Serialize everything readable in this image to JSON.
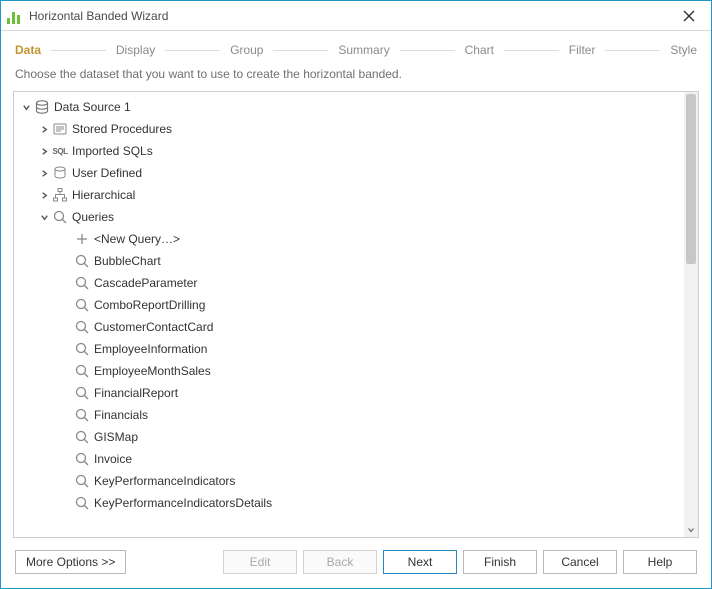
{
  "window": {
    "title": "Horizontal Banded Wizard"
  },
  "steps": [
    {
      "label": "Data",
      "active": true
    },
    {
      "label": "Display",
      "active": false
    },
    {
      "label": "Group",
      "active": false
    },
    {
      "label": "Summary",
      "active": false
    },
    {
      "label": "Chart",
      "active": false
    },
    {
      "label": "Filter",
      "active": false
    },
    {
      "label": "Style",
      "active": false
    }
  ],
  "description": "Choose the dataset that you want to use to create the horizontal banded.",
  "tree": {
    "root": {
      "label": "Data Source 1",
      "icon": "database-icon",
      "expanded": true
    },
    "folders": [
      {
        "label": "Stored Procedures",
        "icon": "stored-proc-icon",
        "expanded": false
      },
      {
        "label": "Imported SQLs",
        "icon": "sql-icon",
        "expanded": false
      },
      {
        "label": "User Defined",
        "icon": "user-def-icon",
        "expanded": false
      },
      {
        "label": "Hierarchical",
        "icon": "hierarchy-icon",
        "expanded": false
      }
    ],
    "queriesFolder": {
      "label": "Queries",
      "icon": "query-icon",
      "expanded": true
    },
    "queries": [
      {
        "label": "<New Query…>",
        "icon": "plus-icon"
      },
      {
        "label": "BubbleChart"
      },
      {
        "label": "CascadeParameter"
      },
      {
        "label": "ComboReportDrilling"
      },
      {
        "label": "CustomerContactCard"
      },
      {
        "label": "EmployeeInformation"
      },
      {
        "label": "EmployeeMonthSales"
      },
      {
        "label": "FinancialReport"
      },
      {
        "label": "Financials"
      },
      {
        "label": "GISMap"
      },
      {
        "label": "Invoice"
      },
      {
        "label": "KeyPerformanceIndicators"
      },
      {
        "label": "KeyPerformanceIndicatorsDetails"
      }
    ]
  },
  "buttons": {
    "more": "More Options >>",
    "edit": "Edit",
    "back": "Back",
    "next": "Next",
    "finish": "Finish",
    "cancel": "Cancel",
    "help": "Help"
  }
}
